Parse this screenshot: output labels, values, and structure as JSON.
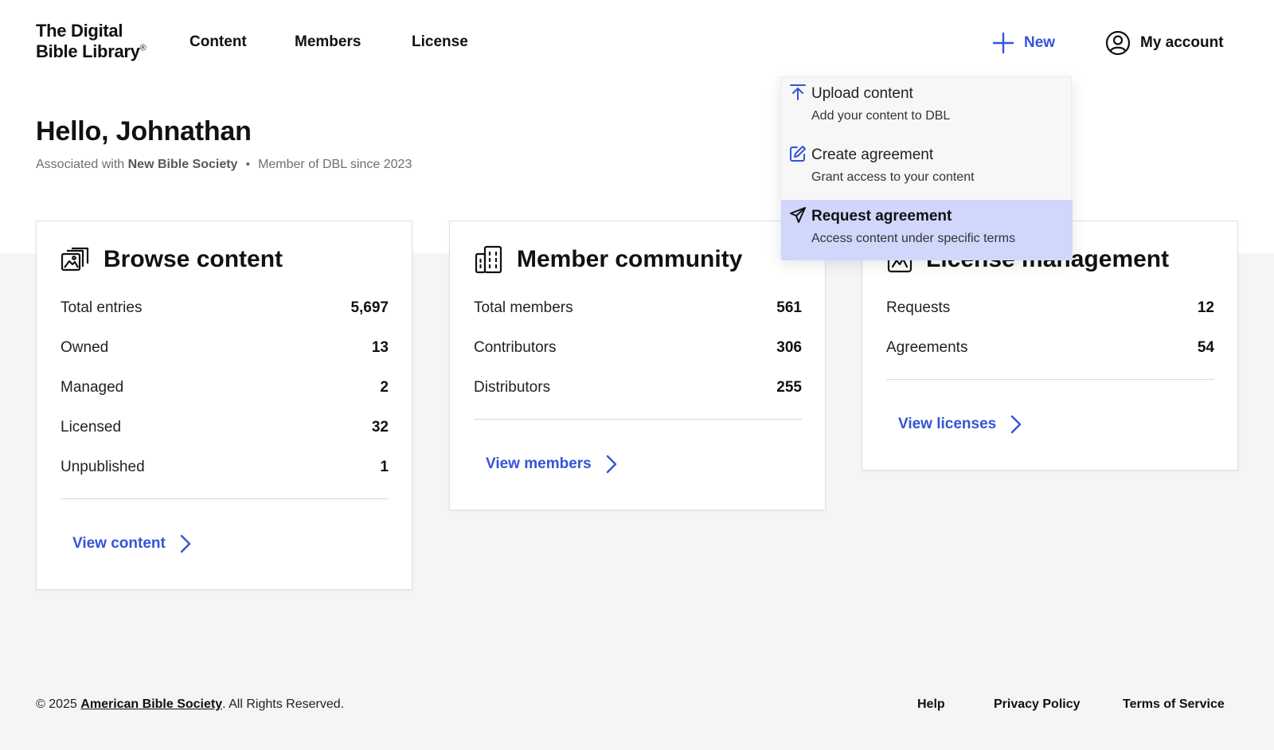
{
  "brand": {
    "logo_line1": "The Digital",
    "logo_line2": "Bible Library",
    "logo_mark": "®"
  },
  "nav": {
    "items": [
      {
        "label": "Content"
      },
      {
        "label": "Members"
      },
      {
        "label": "License"
      }
    ],
    "new_label": "New",
    "account_label": "My account"
  },
  "greeting": {
    "title": "Hello, Johnathan",
    "associated_prefix": "Associated with",
    "organization": "New Bible Society",
    "separator": "•",
    "member_since": "Member of DBL since 2023"
  },
  "new_menu": {
    "items": [
      {
        "title": "Upload content",
        "subtitle": "Add your content to DBL",
        "icon": "upload-icon"
      },
      {
        "title": "Create agreement",
        "subtitle": "Grant access to your content",
        "icon": "edit-icon"
      },
      {
        "title": "Request agreement",
        "subtitle": "Access content under specific terms",
        "icon": "send-icon"
      }
    ],
    "active_index": 2
  },
  "cards": {
    "content": {
      "title": "Browse content",
      "icon": "media-collection-icon",
      "stats": [
        {
          "label": "Total entries",
          "value": "5,697"
        },
        {
          "label": "Owned",
          "value": "13"
        },
        {
          "label": "Managed",
          "value": "2"
        },
        {
          "label": "Licensed",
          "value": "32"
        },
        {
          "label": "Unpublished",
          "value": "1"
        }
      ],
      "link": "View content"
    },
    "members": {
      "title": "Member community",
      "icon": "buildings-icon",
      "stats": [
        {
          "label": "Total members",
          "value": "561"
        },
        {
          "label": "Contributors",
          "value": "306"
        },
        {
          "label": "Distributors",
          "value": "255"
        }
      ],
      "link": "View members"
    },
    "license": {
      "title": "License management",
      "icon": "license-icon",
      "stats": [
        {
          "label": "Requests",
          "value": "12"
        },
        {
          "label": "Agreements",
          "value": "54"
        }
      ],
      "link": "View licenses"
    }
  },
  "footer": {
    "copyright_prefix": "© 2025",
    "org_link": "American Bible Society",
    "copyright_suffix": ". All Rights Reserved.",
    "links": [
      {
        "label": "Help"
      },
      {
        "label": "Privacy Policy"
      },
      {
        "label": "Terms of Service"
      }
    ]
  },
  "colors": {
    "accent": "#3454d9",
    "menu_active_bg": "#d0d7fb",
    "page_bg": "#f4f5f7"
  }
}
